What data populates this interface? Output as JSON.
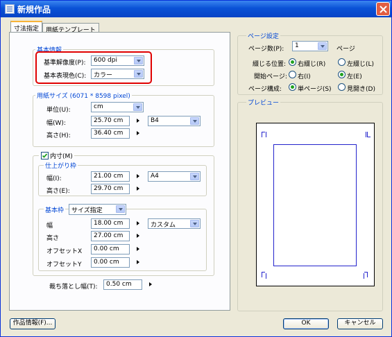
{
  "window": {
    "title": "新規作品"
  },
  "tabs": [
    {
      "label": "寸法指定"
    },
    {
      "label": "用紙テンプレート"
    }
  ],
  "basic_info": {
    "title": "基本情報",
    "resolution_label": "基準解像度(P):",
    "resolution_value": "600 dpi",
    "color_label": "基本表現色(C):",
    "color_value": "カラー"
  },
  "paper_size": {
    "title": "用紙サイズ (6071 * 8598 pixel)",
    "unit_label": "単位(U):",
    "unit_value": "cm",
    "width_label": "幅(W):",
    "width_value": "25.70 cm",
    "height_label": "高さ(H):",
    "height_value": "36.40 cm",
    "preset_value": "B4"
  },
  "inner": {
    "checkbox_label": "内寸(M)",
    "checked": true,
    "finish": {
      "title": "仕上がり枠",
      "width_label": "幅(I):",
      "width_value": "21.00 cm",
      "height_label": "高さ(E):",
      "height_value": "29.70 cm",
      "preset_value": "A4"
    },
    "base": {
      "title_select": "サイズ指定",
      "width_label": "幅",
      "width_value": "18.00 cm",
      "height_label": "高さ",
      "height_value": "27.00 cm",
      "offset_x_label": "オフセットX",
      "offset_x_value": "0.00 cm",
      "offset_y_label": "オフセットY",
      "offset_y_value": "0.00 cm",
      "preset_value": "カスタム",
      "title": "基本枠"
    },
    "bleed_label": "裁ち落とし幅(T):",
    "bleed_value": "0.50 cm"
  },
  "page_settings": {
    "title": "ページ設定",
    "count_label": "ページ数(P):",
    "count_value": "1",
    "count_unit": "ページ",
    "binding_label": "綴じる位置:",
    "binding_right": "右綴じ(R)",
    "binding_left": "左綴じ(L)",
    "start_label": "開始ページ:",
    "start_right": "右(I)",
    "start_left": "左(E)",
    "layout_label": "ページ構成:",
    "layout_single": "単ページ(S)",
    "layout_spread": "見開き(D)"
  },
  "preview": {
    "title": "プレビュー"
  },
  "buttons": {
    "work_info": "作品情報(F)...",
    "ok": "OK",
    "cancel": "キャンセル"
  },
  "colors": {
    "group_title": "#0046d5",
    "highlight": "#e00000",
    "preview_frame": "#2222cc"
  }
}
